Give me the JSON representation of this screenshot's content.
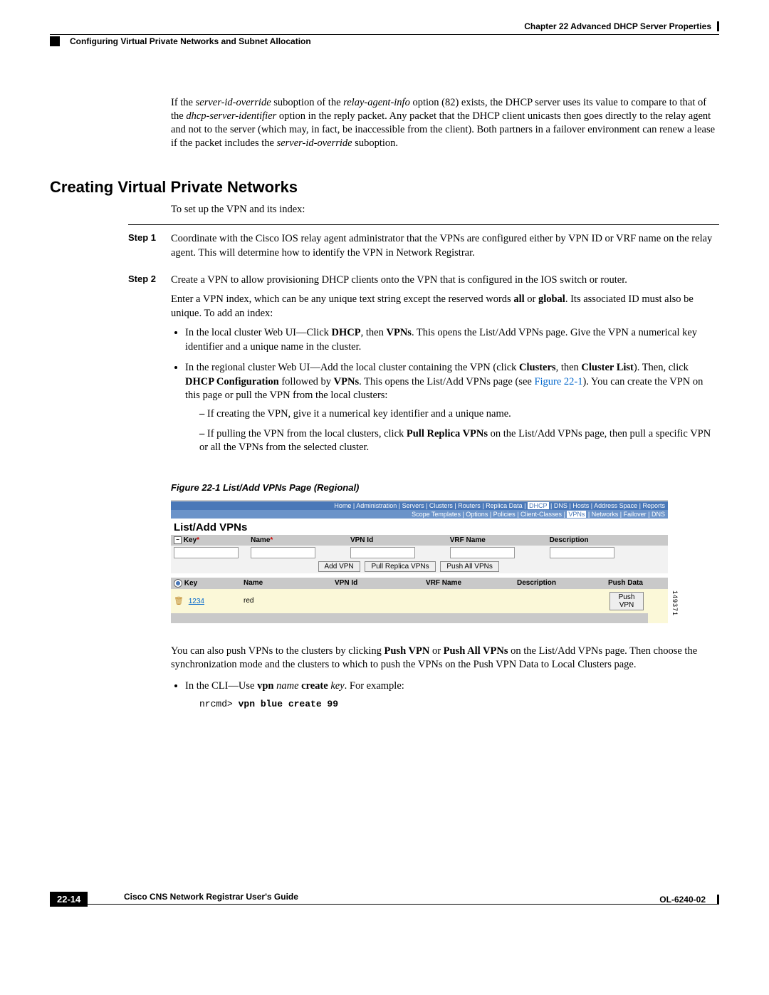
{
  "header": {
    "chapter": "Chapter 22    Advanced DHCP Server Properties",
    "section": "Configuring Virtual Private Networks and Subnet Allocation"
  },
  "intro_paragraph": "If the server-id-override suboption of the relay-agent-info option (82) exists, the DHCP server uses its value to compare to that of the dhcp-server-identifier option in the reply packet. Any packet that the DHCP client unicasts then goes directly to the relay agent and not to the server (which may, in fact, be inaccessible from the client). Both partners in a failover environment can renew a lease if the packet includes the server-id-override suboption.",
  "section_heading": "Creating Virtual Private Networks",
  "lead": "To set up the VPN and its index:",
  "steps": {
    "step1_label": "Step 1",
    "step1_text": "Coordinate with the Cisco IOS relay agent administrator that the VPNs are configured either by VPN ID or VRF name on the relay agent. This will determine how to identify the VPN in Network Registrar.",
    "step2_label": "Step 2",
    "step2_text": "Create a VPN to allow provisioning DHCP clients onto the VPN that is configured in the IOS switch or router.",
    "step2_para2_a": "Enter a VPN index, which can be any unique text string except the reserved words ",
    "step2_para2_b": " or ",
    "step2_para2_c": ". Its associated ID must also be unique. To add an index:",
    "word_all": "all",
    "word_global": "global",
    "bullet1_a": "In the local cluster Web UI—Click ",
    "bullet1_b": ", then ",
    "bullet1_c": ". This opens the List/Add VPNs page. Give the VPN a numerical key identifier and a unique name in the cluster.",
    "word_dhcp": "DHCP",
    "word_vpns": "VPNs",
    "bullet2_a": "In the regional cluster Web UI—Add the local cluster containing the VPN (click ",
    "bullet2_b": ", then ",
    "bullet2_c": "). Then, click ",
    "bullet2_d": " followed by ",
    "bullet2_e": ". This opens the List/Add VPNs page (see ",
    "bullet2_f": "). You can create the VPN on this page or pull the VPN from the local clusters:",
    "word_clusters": "Clusters",
    "word_cluster_list": "Cluster List",
    "word_dhcp_config": "DHCP Configuration",
    "xref": "Figure 22-1",
    "dash1": "If creating the VPN, give it a numerical key identifier and a unique name.",
    "dash2_a": "If pulling the VPN from the local clusters, click ",
    "dash2_b": " on the List/Add VPNs page, then pull a specific VPN or all the VPNs from the selected cluster.",
    "word_pull_replica": "Pull Replica VPNs"
  },
  "figure": {
    "caption": "Figure 22-1   List/Add VPNs Page (Regional)",
    "id_label": "149371",
    "topnav": [
      "Home",
      "Administration",
      "Servers",
      "Clusters",
      "Routers",
      "Replica Data",
      "DHCP",
      "DNS",
      "Hosts",
      "Address Space",
      "Reports"
    ],
    "topnav_active": "DHCP",
    "subnav": [
      "Scope Templates",
      "Options",
      "Policies",
      "Client-Classes",
      "VPNs",
      "Networks",
      "Failover",
      "DNS"
    ],
    "subnav_active": "VPNs",
    "title": "List/Add VPNs",
    "cols": {
      "key": "Key",
      "name": "Name",
      "vpnid": "VPN Id",
      "vrf": "VRF Name",
      "desc": "Description",
      "pushdata": "Push Data"
    },
    "buttons": {
      "add": "Add VPN",
      "pull": "Pull Replica VPNs",
      "pushall": "Push All VPNs",
      "pushone": "Push VPN"
    },
    "row": {
      "key": "1234",
      "name": "red"
    }
  },
  "after_figure": {
    "para_a": "You can also push VPNs to the clusters by clicking ",
    "para_b": " or ",
    "para_c": " on the List/Add VPNs page. Then choose the synchronization mode and the clusters to which to push the VPNs on the Push VPN Data to Local Clusters page.",
    "word_push_vpn": "Push VPN",
    "word_push_all": "Push All VPNs",
    "cli_bullet_a": "In the CLI—Use ",
    "cli_bullet_b": " ",
    "cli_bullet_c": ". For example:",
    "word_vpn": "vpn",
    "word_name": "name",
    "word_create": "create",
    "word_key": "key",
    "cli_prompt": "nrcmd> ",
    "cli_cmd": "vpn blue create 99"
  },
  "footer": {
    "guide": "Cisco CNS Network Registrar User's Guide",
    "pagenum": "22-14",
    "docid": "OL-6240-02"
  }
}
